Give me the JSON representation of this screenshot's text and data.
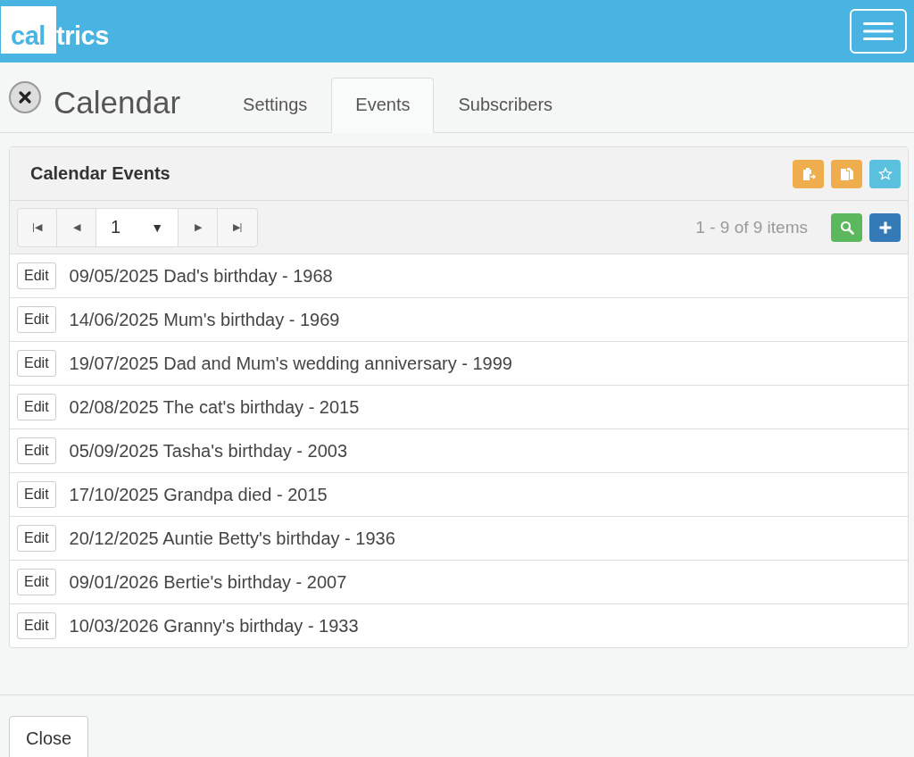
{
  "header": {
    "logo": {
      "boxed": "cal",
      "rest": "trics"
    }
  },
  "page": {
    "title": "Calendar"
  },
  "tabs": [
    {
      "label": "Settings",
      "selected": false
    },
    {
      "label": "Events",
      "selected": true
    },
    {
      "label": "Subscribers",
      "selected": false
    }
  ],
  "panel": {
    "title": "Calendar Events",
    "pager": {
      "first": "|◀",
      "prev": "◀",
      "page": "1",
      "caret": "▼",
      "next": "▶",
      "last": "▶|"
    },
    "count": "1 - 9 of 9 items",
    "rows": [
      {
        "button": "Edit",
        "text": "09/05/2025 Dad's birthday - 1968"
      },
      {
        "button": "Edit",
        "text": "14/06/2025 Mum's birthday - 1969"
      },
      {
        "button": "Edit",
        "text": "19/07/2025 Dad and Mum's wedding anniversary - 1999"
      },
      {
        "button": "Edit",
        "text": "02/08/2025 The cat's birthday - 2015"
      },
      {
        "button": "Edit",
        "text": "05/09/2025 Tasha's birthday - 2003"
      },
      {
        "button": "Edit",
        "text": "17/10/2025 Grandpa died - 2015"
      },
      {
        "button": "Edit",
        "text": "20/12/2025 Auntie Betty's birthday - 1936"
      },
      {
        "button": "Edit",
        "text": "09/01/2026 Bertie's birthday - 2007"
      },
      {
        "button": "Edit",
        "text": "10/03/2026 Granny's birthday - 1933"
      }
    ]
  },
  "footer": {
    "button": "Close"
  }
}
